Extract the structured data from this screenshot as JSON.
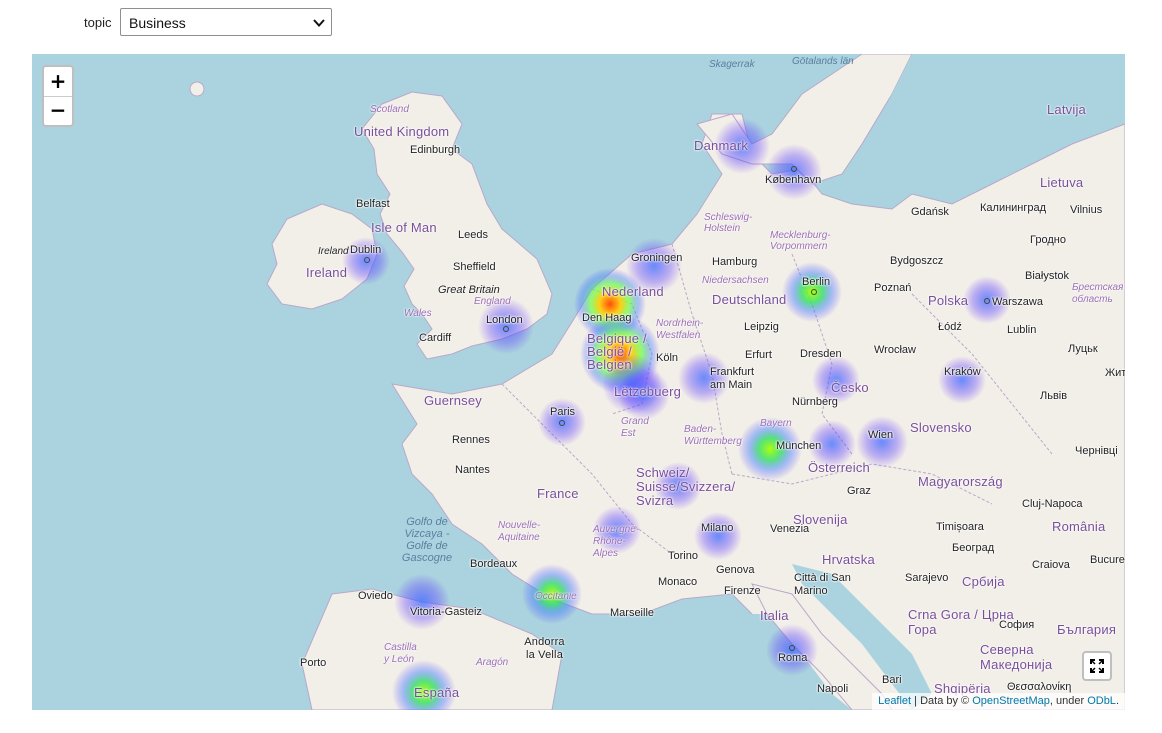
{
  "filter": {
    "label": "topic",
    "selected": "Business"
  },
  "map": {
    "countries": [
      {
        "name": "United Kingdom"
      },
      {
        "name": "Ireland"
      },
      {
        "name": "Isle of Man"
      },
      {
        "name": "Danmark"
      },
      {
        "name": "Nederland"
      },
      {
        "name": "Deutschland"
      },
      {
        "name": "Polska"
      },
      {
        "name": "France"
      },
      {
        "name": "Belgique / België / Belgien"
      },
      {
        "name": "Lëtzebuerg"
      },
      {
        "name": "Schweiz/ Suisse/Svizzera/ Svizra"
      },
      {
        "name": "Česko"
      },
      {
        "name": "Österreich"
      },
      {
        "name": "Slovensko"
      },
      {
        "name": "Magyarország"
      },
      {
        "name": "Slovenija"
      },
      {
        "name": "Hrvatska"
      },
      {
        "name": "Italia"
      },
      {
        "name": "España"
      },
      {
        "name": "Guernsey"
      },
      {
        "name": "România"
      },
      {
        "name": "Србија"
      },
      {
        "name": "Crna Gora / Црна Гора"
      },
      {
        "name": "България"
      },
      {
        "name": "Северна Македонија"
      },
      {
        "name": "Shqipëria"
      },
      {
        "name": "Lietuva"
      },
      {
        "name": "Latvija"
      },
      {
        "name": "Andorra la Vella"
      }
    ],
    "cities": [
      {
        "name": "Edinburgh"
      },
      {
        "name": "Belfast"
      },
      {
        "name": "Dublin"
      },
      {
        "name": "Leeds"
      },
      {
        "name": "Sheffield"
      },
      {
        "name": "London"
      },
      {
        "name": "Cardiff"
      },
      {
        "name": "Groningen"
      },
      {
        "name": "Den Haag"
      },
      {
        "name": "Köln"
      },
      {
        "name": "Hamburg"
      },
      {
        "name": "Berlin"
      },
      {
        "name": "Leipzig"
      },
      {
        "name": "Erfurt"
      },
      {
        "name": "Dresden"
      },
      {
        "name": "Frankfurt am Main"
      },
      {
        "name": "Nürnberg"
      },
      {
        "name": "München"
      },
      {
        "name": "København"
      },
      {
        "name": "Gdańsk"
      },
      {
        "name": "Bydgoszcz"
      },
      {
        "name": "Poznań"
      },
      {
        "name": "Łódź"
      },
      {
        "name": "Warszawa"
      },
      {
        "name": "Wrocław"
      },
      {
        "name": "Kraków"
      },
      {
        "name": "Lublin"
      },
      {
        "name": "Paris"
      },
      {
        "name": "Rennes"
      },
      {
        "name": "Nantes"
      },
      {
        "name": "Bordeaux"
      },
      {
        "name": "Marseille"
      },
      {
        "name": "Monaco"
      },
      {
        "name": "Torino"
      },
      {
        "name": "Milano"
      },
      {
        "name": "Venezia"
      },
      {
        "name": "Genova"
      },
      {
        "name": "Firenze"
      },
      {
        "name": "Città di San Marino"
      },
      {
        "name": "Roma"
      },
      {
        "name": "Napoli"
      },
      {
        "name": "Bari"
      },
      {
        "name": "Wien"
      },
      {
        "name": "Graz"
      },
      {
        "name": "Oviedo"
      },
      {
        "name": "Vitoria-Gasteiz"
      },
      {
        "name": "Porto"
      },
      {
        "name": "Калининград"
      },
      {
        "name": "Vilnius"
      },
      {
        "name": "Гродно"
      },
      {
        "name": "Białystok"
      },
      {
        "name": "Луцьк"
      },
      {
        "name": "Львів"
      },
      {
        "name": "Чернівці"
      },
      {
        "name": "Cluj-Napoca"
      },
      {
        "name": "Timișoara"
      },
      {
        "name": "Београд"
      },
      {
        "name": "Craiova"
      },
      {
        "name": "Sarajevo"
      },
      {
        "name": "София"
      },
      {
        "name": "Θεσσαλονίκη"
      },
      {
        "name": "Bucureș"
      },
      {
        "name": "Жит"
      }
    ],
    "regions": [
      {
        "name": "Scotland"
      },
      {
        "name": "England"
      },
      {
        "name": "Wales"
      },
      {
        "name": "Schleswig-Holstein"
      },
      {
        "name": "Mecklenburg-Vorpommern"
      },
      {
        "name": "Niedersachsen"
      },
      {
        "name": "Nordrhein-Westfalen"
      },
      {
        "name": "Bayern"
      },
      {
        "name": "Baden-Württemberg"
      },
      {
        "name": "Grand Est"
      },
      {
        "name": "Nouvelle-Aquitaine"
      },
      {
        "name": "Auvergne-Rhône-Alpes"
      },
      {
        "name": "Occitanie"
      },
      {
        "name": "Castilla y León"
      },
      {
        "name": "Aragón"
      },
      {
        "name": "Брестская область"
      }
    ],
    "seas": [
      {
        "name": "Golfo de Vizcaya - Golfe de Gascogne"
      },
      {
        "name": "Skagerrak"
      },
      {
        "name": "Götalands län"
      }
    ],
    "islands": [
      {
        "name": "Ireland"
      },
      {
        "name": "Great Britain"
      }
    ],
    "heatmap_points": [
      {
        "place": "Den Haag",
        "intensity": 0.95
      },
      {
        "place": "Belgique/België",
        "intensity": 0.9
      },
      {
        "place": "Berlin",
        "intensity": 0.55
      },
      {
        "place": "München",
        "intensity": 0.55
      },
      {
        "place": "Occitanie",
        "intensity": 0.5
      },
      {
        "place": "España",
        "intensity": 0.55
      },
      {
        "place": "Lëtzebuerg",
        "intensity": 0.35
      },
      {
        "place": "Groningen",
        "intensity": 0.25
      },
      {
        "place": "London",
        "intensity": 0.25
      },
      {
        "place": "Dublin",
        "intensity": 0.2
      },
      {
        "place": "Paris",
        "intensity": 0.2
      },
      {
        "place": "Frankfurt am Main",
        "intensity": 0.25
      },
      {
        "place": "Česko",
        "intensity": 0.2
      },
      {
        "place": "Wien",
        "intensity": 0.25
      },
      {
        "place": "Kraków",
        "intensity": 0.2
      },
      {
        "place": "Warszawa",
        "intensity": 0.2
      },
      {
        "place": "Danmark",
        "intensity": 0.25
      },
      {
        "place": "København",
        "intensity": 0.25
      },
      {
        "place": "Schweiz",
        "intensity": 0.2
      },
      {
        "place": "Auvergne-Rhône-Alpes",
        "intensity": 0.2
      },
      {
        "place": "Milano",
        "intensity": 0.2
      },
      {
        "place": "Roma",
        "intensity": 0.2
      },
      {
        "place": "Vitoria-Gasteiz",
        "intensity": 0.25
      }
    ]
  },
  "controls": {
    "zoom_in": "+",
    "zoom_out": "−",
    "fullscreen_icon": "fullscreen-icon"
  },
  "attribution": {
    "leaflet": "Leaflet",
    "sep": " | Data by © ",
    "osm": "OpenStreetMap",
    "under": ", under ",
    "odbl": "ODbL",
    "end": "."
  }
}
